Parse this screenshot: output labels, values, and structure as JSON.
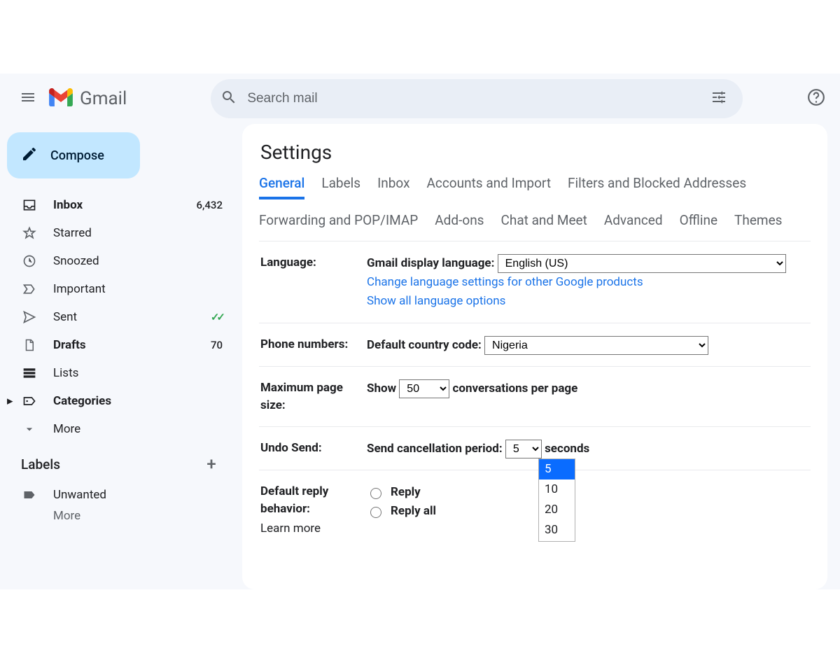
{
  "header": {
    "logo_text": "Gmail",
    "search_placeholder": "Search mail"
  },
  "compose": {
    "label": "Compose"
  },
  "sidebar": {
    "items": [
      {
        "label": "Inbox",
        "count": "6,432",
        "bold": true,
        "icon": "inbox"
      },
      {
        "label": "Starred",
        "icon": "star"
      },
      {
        "label": "Snoozed",
        "icon": "clock"
      },
      {
        "label": "Important",
        "icon": "important"
      },
      {
        "label": "Sent",
        "icon": "send",
        "check": true
      },
      {
        "label": "Drafts",
        "count": "70",
        "bold": true,
        "icon": "draft"
      },
      {
        "label": "Lists",
        "icon": "lists"
      },
      {
        "label": "Categories",
        "bold": true,
        "icon": "categories",
        "expand": true
      },
      {
        "label": "More",
        "icon": "more"
      }
    ],
    "labels_header": "Labels",
    "labels": [
      {
        "label": "Unwanted",
        "icon": "label"
      }
    ],
    "placeholder_more": "More"
  },
  "settings": {
    "title": "Settings",
    "tabs": [
      "General",
      "Labels",
      "Inbox",
      "Accounts and Import",
      "Filters and Blocked Addresses",
      "Forwarding and POP/IMAP",
      "Add-ons",
      "Chat and Meet",
      "Advanced",
      "Offline",
      "Themes"
    ],
    "language": {
      "row_label": "Language:",
      "display_label": "Gmail display language:",
      "value": "English (US)",
      "link1": "Change language settings for other Google products",
      "link2": "Show all language options"
    },
    "phone": {
      "row_label": "Phone numbers:",
      "field_label": "Default country code:",
      "value": "Nigeria"
    },
    "page_size": {
      "row_label": "Maximum page size:",
      "prefix": "Show",
      "value": "50",
      "suffix": "conversations per page"
    },
    "undo": {
      "row_label": "Undo Send:",
      "field_label": "Send cancellation period:",
      "value": "5",
      "suffix": "seconds",
      "options": [
        "5",
        "10",
        "20",
        "30"
      ]
    },
    "reply": {
      "row_label": "Default reply behavior:",
      "opt1": "Reply",
      "opt2": "Reply all",
      "learn_more": "Learn more"
    }
  }
}
